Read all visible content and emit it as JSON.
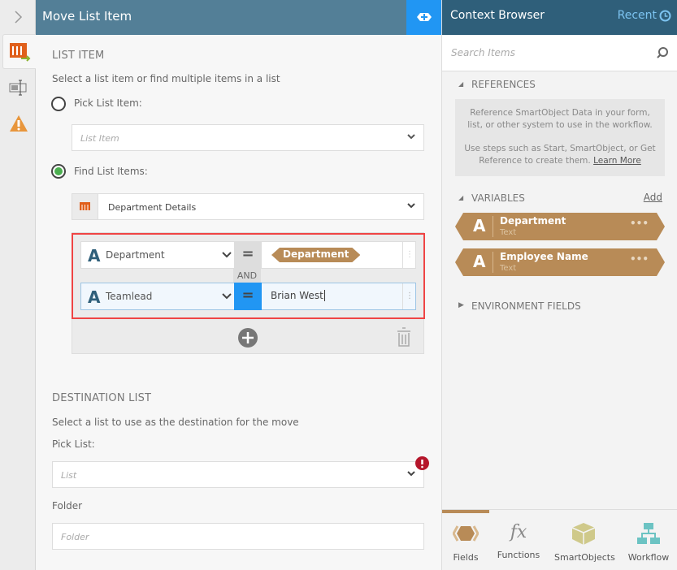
{
  "header": {
    "title": "Move List Item"
  },
  "list_item": {
    "section": "LIST ITEM",
    "description": "Select a list item or find multiple items in a list",
    "pick_label": "Pick List Item:",
    "pick_placeholder": "List Item",
    "find_label": "Find List Items:",
    "list_value": "Department Details",
    "filters": [
      {
        "field": "Department",
        "operator": "=",
        "value": "Department",
        "value_type": "variable"
      },
      {
        "field": "Teamlead",
        "operator": "=",
        "value": "Brian West",
        "value_type": "text"
      }
    ],
    "joiner": "AND"
  },
  "destination": {
    "section": "DESTINATION LIST",
    "description": "Select a list to use as the destination for the move",
    "pick_label": "Pick List:",
    "list_placeholder": "List",
    "folder_label": "Folder",
    "folder_placeholder": "Folder"
  },
  "context": {
    "title": "Context Browser",
    "recent": "Recent",
    "search_placeholder": "Search Items",
    "references": "REFERENCES",
    "ref_text1": "Reference SmartObject Data in your form, list, or other system to use in the workflow.",
    "ref_text2": "Use steps such as Start, SmartObject, or Get Reference to create them.",
    "learn_more": "Learn More",
    "variables": "VARIABLES",
    "add": "Add",
    "vars": [
      {
        "name": "Department",
        "type": "Text"
      },
      {
        "name": "Employee Name",
        "type": "Text"
      }
    ],
    "env": "ENVIRONMENT FIELDS",
    "tabs": [
      "Fields",
      "Functions",
      "SmartObjects",
      "Workflow"
    ]
  },
  "colors": {
    "accent": "#2196f3",
    "variable": "#b88b57",
    "header": "#537f97",
    "highlight": "#ef4444"
  }
}
